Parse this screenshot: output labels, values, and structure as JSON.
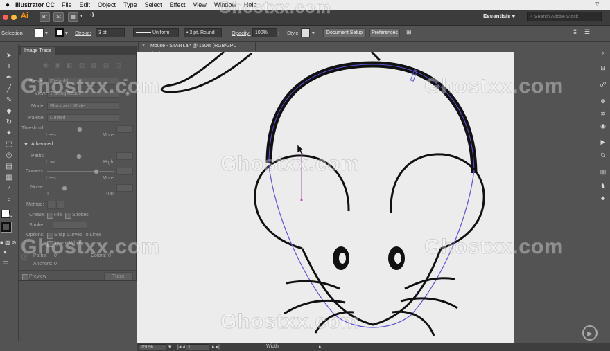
{
  "menubar": {
    "apple": "",
    "app_name": "Illustrator CC",
    "items": [
      "File",
      "Edit",
      "Object",
      "Type",
      "Select",
      "Effect",
      "View",
      "Window",
      "Help"
    ]
  },
  "appbar": {
    "logo": "Ai",
    "workspace": "Essentials",
    "search_placeholder": "Search Adobe Stock"
  },
  "control": {
    "selection": "Selection",
    "stroke_label": "Stroke:",
    "stroke_value": "3 pt",
    "profile": "Uniform",
    "brush": "3 pt. Round",
    "opacity_label": "Opacity:",
    "opacity_value": "100%",
    "style_label": "Style:",
    "document_setup": "Document Setup",
    "preferences": "Preferences"
  },
  "panel": {
    "title": "Image Trace",
    "preset_label": "Preset:",
    "preset_value": "[Default]",
    "view_label": "View:",
    "view_value": "Tracing Result",
    "mode_label": "Mode:",
    "mode_value": "Black and White",
    "palette_label": "Palette:",
    "palette_value": "Limited",
    "threshold_label": "Threshold:",
    "less": "Less",
    "more": "More",
    "advanced": "Advanced",
    "paths_label": "Paths:",
    "low": "Low",
    "high": "High",
    "corners_label": "Corners:",
    "noise_label": "Noise:",
    "noise_min": "1",
    "noise_max": "100",
    "method_label": "Method:",
    "create_label": "Create:",
    "fills": "Fills",
    "strokes": "Strokes",
    "stroke_label": "Stroke:",
    "options_label": "Options:",
    "snap_curves": "Snap Curves To Lines",
    "ignore_white": "Ignore White",
    "paths_count_label": "Paths:",
    "paths_count": "0",
    "colors_label": "Colors:",
    "colors_count": "0",
    "anchors_label": "Anchors:",
    "anchors_count": "0",
    "preview": "Preview",
    "trace": "Trace"
  },
  "document": {
    "close": "×",
    "tab_title": "Mouse - START.ai* @ 150% (RGB/GPU Preview)"
  },
  "status": {
    "zoom": "150%",
    "page": "1",
    "tool": "Width"
  },
  "watermark": "Ghostxx.com",
  "colors": {
    "ai_orange": "#ff9a00",
    "path_selection": "#5a52d6",
    "handle_magenta": "#b04ab0",
    "stroke": "#111111"
  }
}
